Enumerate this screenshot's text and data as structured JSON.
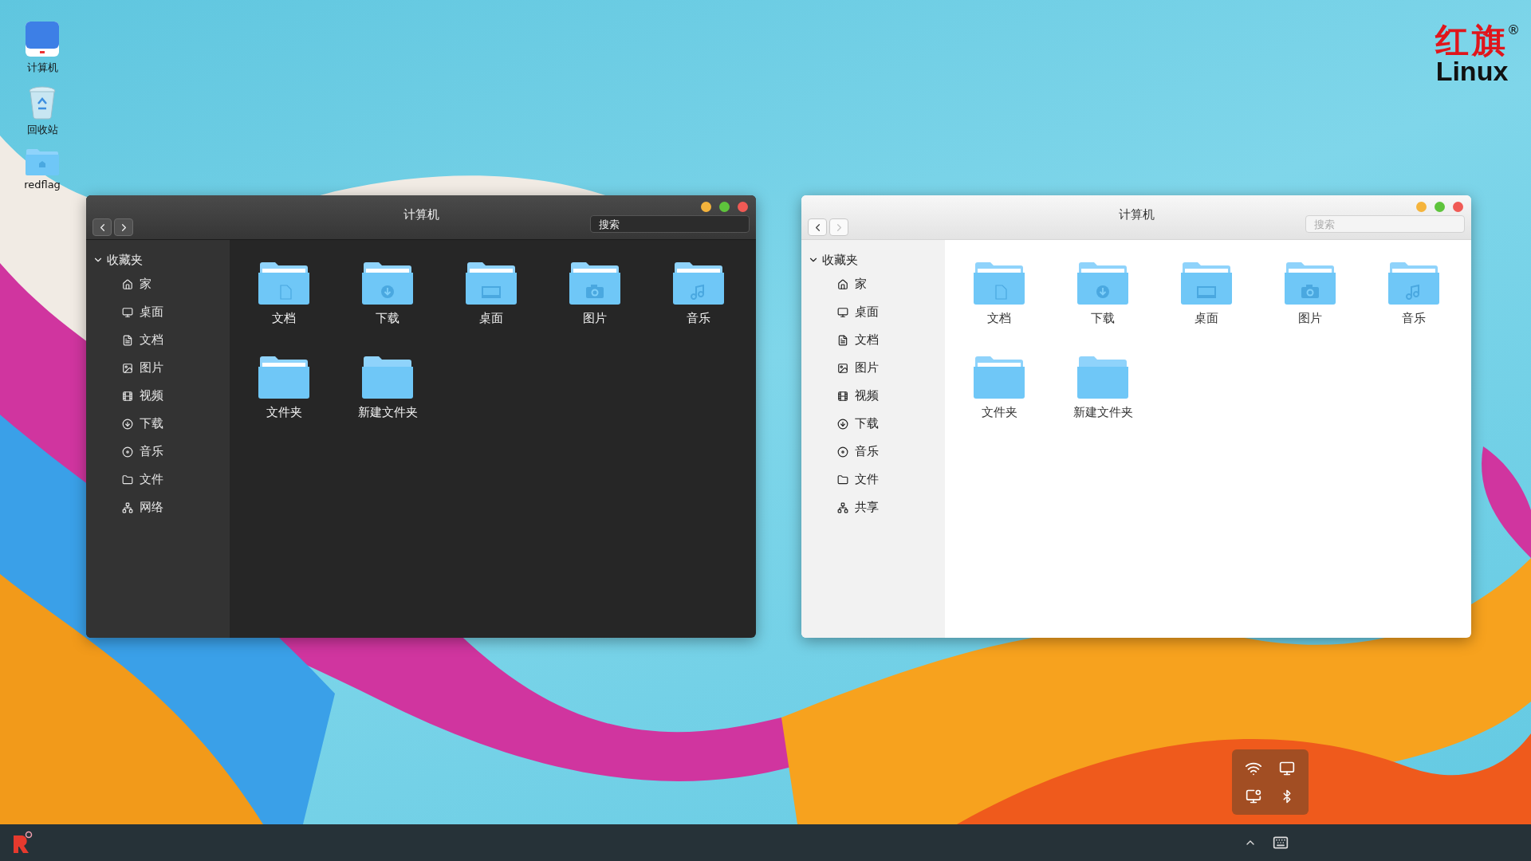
{
  "desktop_icons": [
    {
      "label": "计算机",
      "kind": "computer"
    },
    {
      "label": "回收站",
      "kind": "trash"
    },
    {
      "label": "redflag",
      "kind": "home-folder"
    }
  ],
  "logo": {
    "title": "红旗",
    "subtitle": "Linux",
    "mark": "®"
  },
  "windows": [
    {
      "kind": "dark",
      "title": "计算机",
      "back_enabled": true,
      "forward_enabled": true,
      "search": {
        "placeholder": "搜索"
      },
      "sidebar": {
        "section": "收藏夹",
        "expanded": true,
        "items": [
          {
            "label": "家",
            "kind": "home"
          },
          {
            "label": "桌面",
            "kind": "desktop"
          },
          {
            "label": "文档",
            "kind": "document"
          },
          {
            "label": "图片",
            "kind": "picture"
          },
          {
            "label": "视频",
            "kind": "video"
          },
          {
            "label": "下载",
            "kind": "download"
          },
          {
            "label": "音乐",
            "kind": "music"
          },
          {
            "label": "文件",
            "kind": "file"
          },
          {
            "label": "网络",
            "kind": "network"
          }
        ]
      },
      "folders": [
        {
          "label": "文档",
          "kind": "document"
        },
        {
          "label": "下载",
          "kind": "download"
        },
        {
          "label": "桌面",
          "kind": "desktop"
        },
        {
          "label": "图片",
          "kind": "picture"
        },
        {
          "label": "音乐",
          "kind": "music"
        },
        {
          "label": "文件夹",
          "kind": "plain"
        },
        {
          "label": "新建文件夹",
          "kind": "new"
        }
      ]
    },
    {
      "kind": "light",
      "title": "计算机",
      "back_enabled": true,
      "forward_enabled": false,
      "search": {
        "placeholder": "搜索"
      },
      "sidebar": {
        "section": "收藏夹",
        "expanded": true,
        "items": [
          {
            "label": "家",
            "kind": "home"
          },
          {
            "label": "桌面",
            "kind": "desktop"
          },
          {
            "label": "文档",
            "kind": "document"
          },
          {
            "label": "图片",
            "kind": "picture"
          },
          {
            "label": "视频",
            "kind": "video"
          },
          {
            "label": "下载",
            "kind": "download"
          },
          {
            "label": "音乐",
            "kind": "music"
          },
          {
            "label": "文件",
            "kind": "file"
          },
          {
            "label": "共享",
            "kind": "network"
          }
        ]
      },
      "folders": [
        {
          "label": "文档",
          "kind": "document"
        },
        {
          "label": "下载",
          "kind": "download"
        },
        {
          "label": "桌面",
          "kind": "desktop"
        },
        {
          "label": "图片",
          "kind": "picture"
        },
        {
          "label": "音乐",
          "kind": "music"
        },
        {
          "label": "文件夹",
          "kind": "plain"
        },
        {
          "label": "新建文件夹",
          "kind": "new"
        }
      ]
    }
  ]
}
